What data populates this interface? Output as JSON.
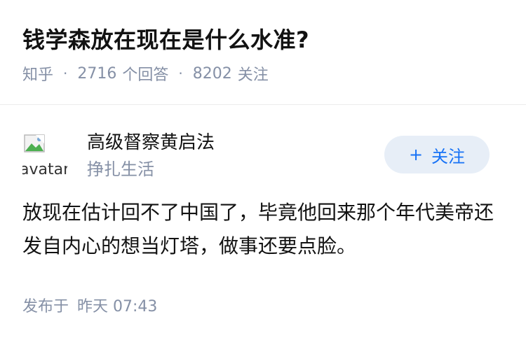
{
  "question": {
    "title": "钱学森放在现在是什么水准?",
    "source": "知乎",
    "separator": "·",
    "answer_count": "2716",
    "answer_label": "个回答",
    "follower_count": "8202",
    "follower_label": "关注"
  },
  "answer": {
    "author": {
      "avatar_alt": "avatar",
      "name": "高级督察黄启法",
      "bio": "挣扎生活"
    },
    "follow_button": {
      "plus": "+",
      "label": "关注"
    },
    "content": "放现在估计回不了中国了，毕竟他回来那个年代美帝还发自内心的想当灯塔，做事还要点脸。",
    "published_label": "发布于",
    "published_time": "昨天 07:43"
  },
  "colors": {
    "primary_text": "#121212",
    "secondary_text": "#8590a6",
    "accent": "#1772f6",
    "button_bg": "#e7eef7"
  }
}
